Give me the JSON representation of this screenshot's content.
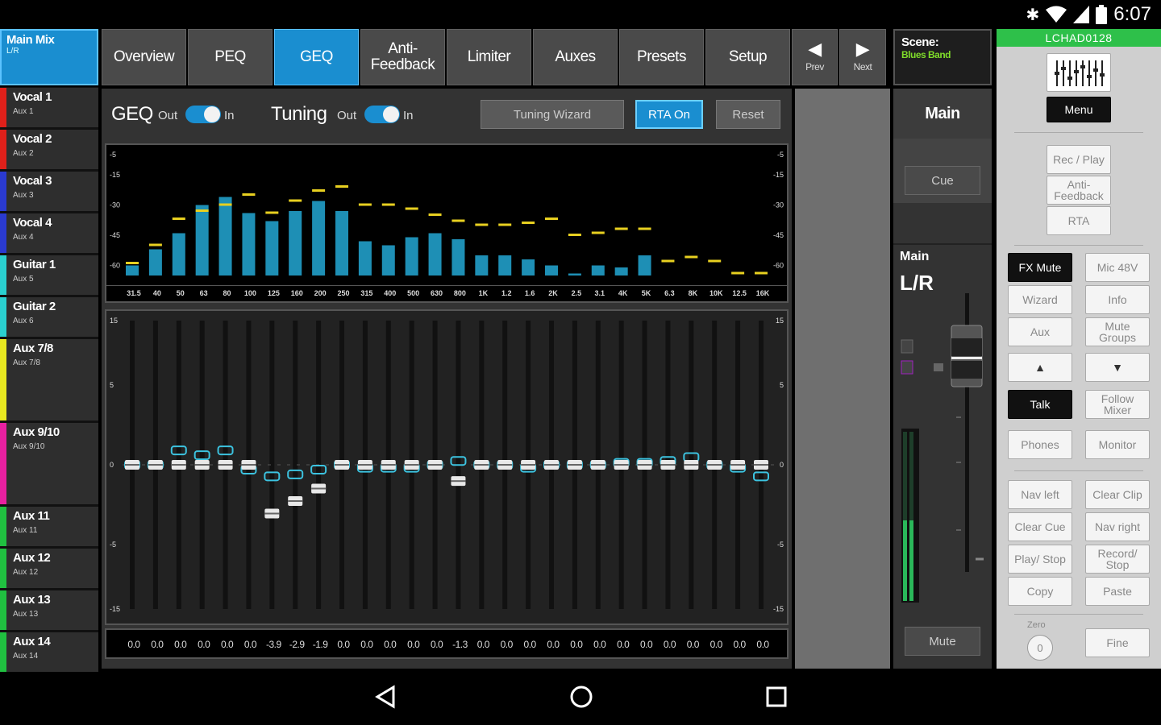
{
  "status": {
    "time": "6:07"
  },
  "main_mix": {
    "name": "Main Mix",
    "sub": "L/R"
  },
  "channels": [
    {
      "name": "Vocal 1",
      "sub": "Aux 1",
      "color": "#e0201a"
    },
    {
      "name": "Vocal 2",
      "sub": "Aux 2",
      "color": "#e0201a"
    },
    {
      "name": "Vocal 3",
      "sub": "Aux 3",
      "color": "#2a3ad0"
    },
    {
      "name": "Vocal 4",
      "sub": "Aux 4",
      "color": "#2a3ad0"
    },
    {
      "name": "Guitar 1",
      "sub": "Aux 5",
      "color": "#2ad0d0"
    },
    {
      "name": "Guitar 2",
      "sub": "Aux 6",
      "color": "#2ad0d0"
    },
    {
      "name": "Aux 7/8",
      "sub": "Aux 7/8",
      "color": "#e8e820"
    },
    {
      "name": "Aux 9/10",
      "sub": "Aux 9/10",
      "color": "#e820a0"
    },
    {
      "name": "Aux 11",
      "sub": "Aux 11",
      "color": "#20c040"
    },
    {
      "name": "Aux 12",
      "sub": "Aux 12",
      "color": "#20c040"
    },
    {
      "name": "Aux 13",
      "sub": "Aux 13",
      "color": "#20c040"
    },
    {
      "name": "Aux 14",
      "sub": "Aux 14",
      "color": "#20c040"
    }
  ],
  "tabs": [
    {
      "label": "Overview",
      "active": false
    },
    {
      "label": "PEQ",
      "active": false
    },
    {
      "label": "GEQ",
      "active": true
    },
    {
      "label": "Anti-\nFeedback",
      "active": false
    },
    {
      "label": "Limiter",
      "active": false
    },
    {
      "label": "Auxes",
      "active": false
    },
    {
      "label": "Presets",
      "active": false
    },
    {
      "label": "Setup",
      "active": false
    }
  ],
  "nav": {
    "prev": "Prev",
    "next": "Next"
  },
  "geq": {
    "label": "GEQ",
    "out": "Out",
    "in": "In",
    "tuning_label": "Tuning",
    "tuning_out": "Out",
    "tuning_in": "In",
    "tuning_wizard": "Tuning Wizard",
    "rta_on": "RTA On",
    "reset": "Reset",
    "rta_scale": [
      "-5",
      "-15",
      "-30",
      "-45",
      "-60"
    ],
    "eq_scale": [
      "15",
      "5",
      "0",
      "-5",
      "-15"
    ],
    "frequencies": [
      "31.5",
      "40",
      "50",
      "63",
      "80",
      "100",
      "125",
      "160",
      "200",
      "250",
      "315",
      "400",
      "500",
      "630",
      "800",
      "1K",
      "1.2",
      "1.6",
      "2K",
      "2.5",
      "3.1",
      "4K",
      "5K",
      "6.3",
      "8K",
      "10K",
      "12.5",
      "16K"
    ],
    "gains": [
      "0.0",
      "0.0",
      "0.0",
      "0.0",
      "0.0",
      "0.0",
      "-3.9",
      "-2.9",
      "-1.9",
      "0.0",
      "0.0",
      "0.0",
      "0.0",
      "0.0",
      "-1.3",
      "0.0",
      "0.0",
      "0.0",
      "0.0",
      "0.0",
      "0.0",
      "0.0",
      "0.0",
      "0.0",
      "0.0",
      "0.0",
      "0.0",
      "0.0"
    ],
    "rta_levels_db": [
      -60,
      -52,
      -44,
      -30,
      -26,
      -34,
      -38,
      -33,
      -28,
      -33,
      -48,
      -50,
      -46,
      -44,
      -47,
      -55,
      -55,
      -57,
      -60,
      -64,
      -60,
      -61,
      -55,
      -66,
      -67,
      -68,
      -69,
      -69
    ],
    "rta_peaks_db": [
      -59,
      -50,
      -37,
      -33,
      -30,
      -25,
      -34,
      -28,
      -23,
      -21,
      -30,
      -30,
      -32,
      -35,
      -38,
      -40,
      -40,
      -39,
      -37,
      -45,
      -44,
      -42,
      -42,
      -58,
      -56,
      -58,
      -64,
      -64
    ],
    "eq_target_db": [
      0,
      0,
      1.5,
      1.0,
      1.5,
      -0.5,
      -1.2,
      -1.0,
      -0.5,
      0,
      -0.3,
      -0.3,
      -0.3,
      0,
      0.4,
      0,
      0,
      -0.3,
      0,
      0,
      0,
      0.2,
      0.2,
      0.4,
      0.8,
      0,
      -0.3,
      -1.2
    ]
  },
  "scene": {
    "label": "Scene:",
    "name": "Blues Band"
  },
  "master": {
    "title": "Main",
    "cue": "Cue",
    "bus": "Main",
    "bus_sub": "L/R",
    "mute": "Mute"
  },
  "right": {
    "mixer_id": "LCHAD0128",
    "menu": "Menu",
    "rec_play": "Rec / Play",
    "anti_feedback": "Anti-\nFeedback",
    "rta": "RTA",
    "fx_mute": "FX Mute",
    "mic48": "Mic 48V",
    "wizard": "Wizard",
    "info": "Info",
    "aux": "Aux",
    "mute_groups": "Mute\nGroups",
    "talk": "Talk",
    "follow_mixer": "Follow\nMixer",
    "phones": "Phones",
    "monitor": "Monitor",
    "nav_left": "Nav left",
    "clear_clip": "Clear Clip",
    "clear_cue": "Clear Cue",
    "nav_right": "Nav right",
    "play_stop": "Play/ Stop",
    "record_stop": "Record/\nStop",
    "copy": "Copy",
    "paste": "Paste",
    "zero": "Zero",
    "zero_val": "0",
    "fine": "Fine"
  }
}
